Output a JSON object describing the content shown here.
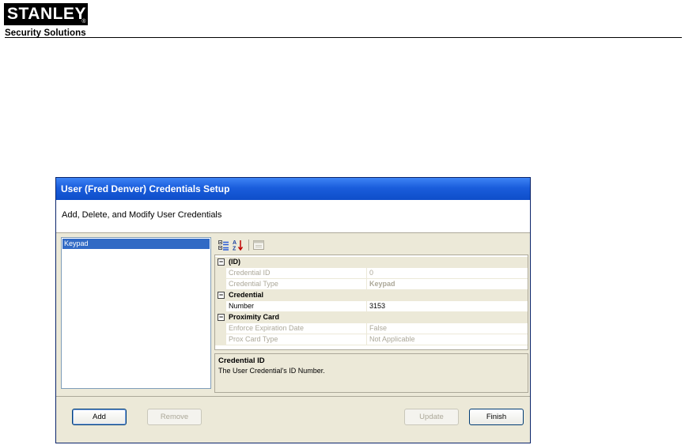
{
  "document": {
    "logo_text": "STANLEY",
    "logo_mark": "®",
    "tagline": "Security Solutions"
  },
  "window": {
    "title": "User (Fred Denver) Credentials Setup",
    "banner_text": "Add, Delete, and Modify User Credentials"
  },
  "credential_list": {
    "items": [
      {
        "label": "Keypad",
        "selected": true
      }
    ]
  },
  "toolbar": {
    "icons": [
      "categorized-icon",
      "alphabetical-icon",
      "property-pages-icon"
    ]
  },
  "property_grid": {
    "categories": [
      {
        "label": "(ID)",
        "toggle": "−",
        "properties": [
          {
            "name": "Credential ID",
            "value": "0",
            "readonly": true
          },
          {
            "name": "Credential Type",
            "value": "Keypad",
            "readonly": true
          }
        ]
      },
      {
        "label": "Credential",
        "toggle": "−",
        "properties": [
          {
            "name": "Number",
            "value": "3153",
            "readonly": false
          }
        ]
      },
      {
        "label": "Proximity Card",
        "toggle": "−",
        "properties": [
          {
            "name": "Enforce Expiration Date",
            "value": "False",
            "readonly": true
          },
          {
            "name": "Prox Card Type",
            "value": "Not Applicable",
            "readonly": true
          }
        ]
      }
    ]
  },
  "description": {
    "title": "Credential ID",
    "text": "The User Credential's ID Number."
  },
  "buttons": {
    "add": "Add",
    "remove": "Remove",
    "update": "Update",
    "finish": "Finish"
  },
  "colors": {
    "titlebar": "#0e4ec9",
    "selection": "#316ac5",
    "window_face": "#ece9d8"
  }
}
